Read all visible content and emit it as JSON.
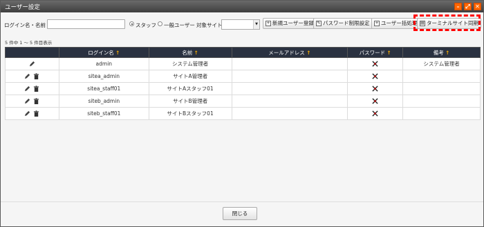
{
  "window": {
    "title": "ユーザー設定",
    "min_icon": "minimize-icon",
    "max_icon": "maximize-icon",
    "close_icon": "close-icon",
    "accent": "#ff6600"
  },
  "toolbar": {
    "login_name_label": "ログイン名・名前",
    "login_name_value": "",
    "radio_staff": "スタッフ",
    "radio_general": "一般ユーザー",
    "target_site_label": "対象サイト",
    "target_site_value": "",
    "btn_new_user": "新規ユーザー登録",
    "btn_password_policy": "パスワード制限設定",
    "btn_bulk": "ユーザー括処理",
    "btn_terminal": "ターミナルサイト同期"
  },
  "list": {
    "count_text": "5 件中 1 ～ 5 件目表示",
    "columns": [
      "",
      "ログイン名",
      "名前",
      "メールアドレス",
      "パスワード",
      "備考"
    ],
    "rows": [
      {
        "login": "admin",
        "name": "システム管理者",
        "email": "",
        "note": "システム管理者",
        "deletable": false
      },
      {
        "login": "sitea_admin",
        "name": "サイトA管理者",
        "email": "",
        "note": "",
        "deletable": true
      },
      {
        "login": "sitea_staff01",
        "name": "サイトAスタッフ01",
        "email": "",
        "note": "",
        "deletable": true
      },
      {
        "login": "siteb_admin",
        "name": "サイトB管理者",
        "email": "",
        "note": "",
        "deletable": true
      },
      {
        "login": "siteb_staff01",
        "name": "サイトBスタッフ01",
        "email": "",
        "note": "",
        "deletable": true
      }
    ]
  },
  "footer": {
    "close_label": "閉じる"
  }
}
